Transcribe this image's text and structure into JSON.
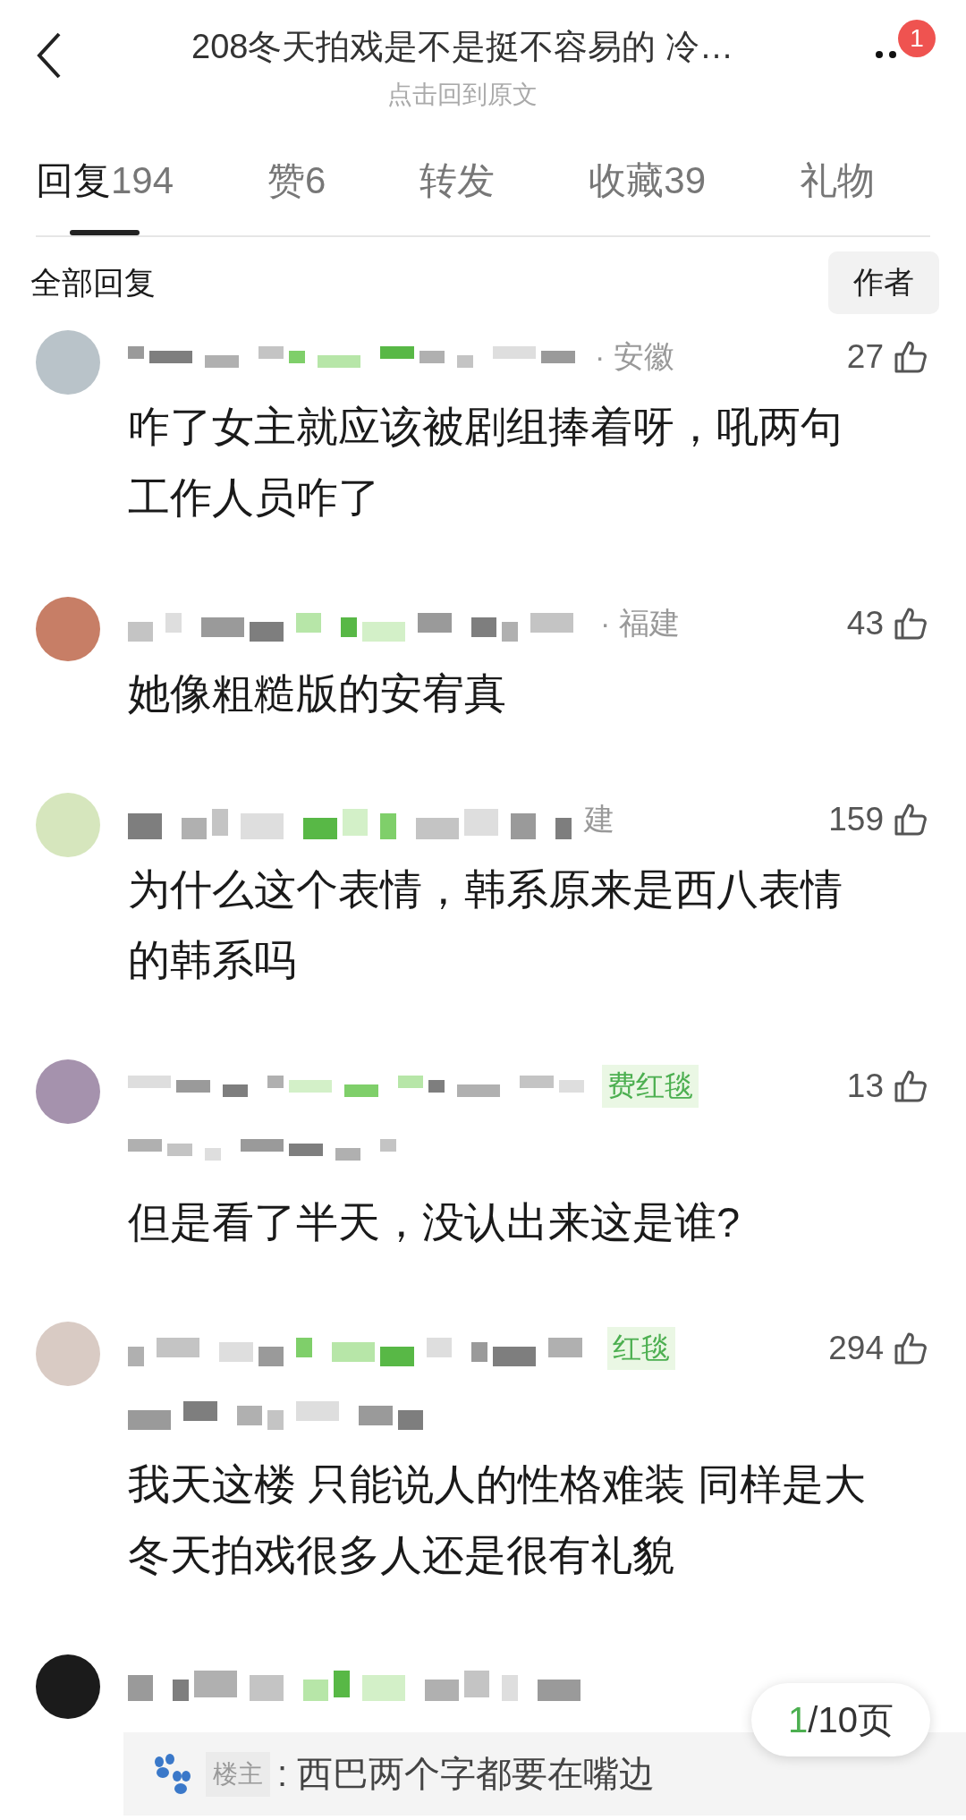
{
  "header": {
    "title": "208冬天拍戏是不是挺不容易的 冷…",
    "subtitle": "点击回到原文",
    "notification_count": "1"
  },
  "tabs": [
    {
      "label": "回复",
      "count": "194",
      "selected": true
    },
    {
      "label": "赞",
      "count": "6",
      "selected": false
    },
    {
      "label": "转发",
      "selected": false
    },
    {
      "label": "收藏",
      "count": "39",
      "selected": false
    },
    {
      "label": "礼物",
      "selected": false
    }
  ],
  "section": {
    "title": "全部回复",
    "filter_button": "作者"
  },
  "comments": [
    {
      "kind": "single",
      "color": "#b9c3c9",
      "location": "· 安徽",
      "likes": "27",
      "text": "咋了女主就应该被剧组捧着呀，吼两句工作人员咋了"
    },
    {
      "kind": "single",
      "color": "#c77e66",
      "location": "· 福建",
      "likes": "43",
      "text": "她像粗糙版的安宥真"
    },
    {
      "kind": "single",
      "color": "#d6e6bd",
      "location": "建",
      "likes": "159",
      "text": "为什么这个表情，韩系原来是西八表情的韩系吗"
    },
    {
      "kind": "double",
      "color": "#a592ad",
      "badge": "费红毯",
      "likes": "13",
      "text": "但是看了半天，没认出来这是谁?"
    },
    {
      "kind": "double",
      "color": "#d9cbc4",
      "badge": "红毯",
      "likes": "294",
      "text": "我天这楼 只能说人的性格难装 同样是大冬天拍戏很多人还是很有礼貌"
    },
    {
      "kind": "single",
      "color": "#1b1b1b"
    }
  ],
  "pager": {
    "current": "1",
    "total": "/10页"
  },
  "reply_preview": {
    "role": "楼主",
    "text": ": 西巴两个字都要在嘴边"
  }
}
